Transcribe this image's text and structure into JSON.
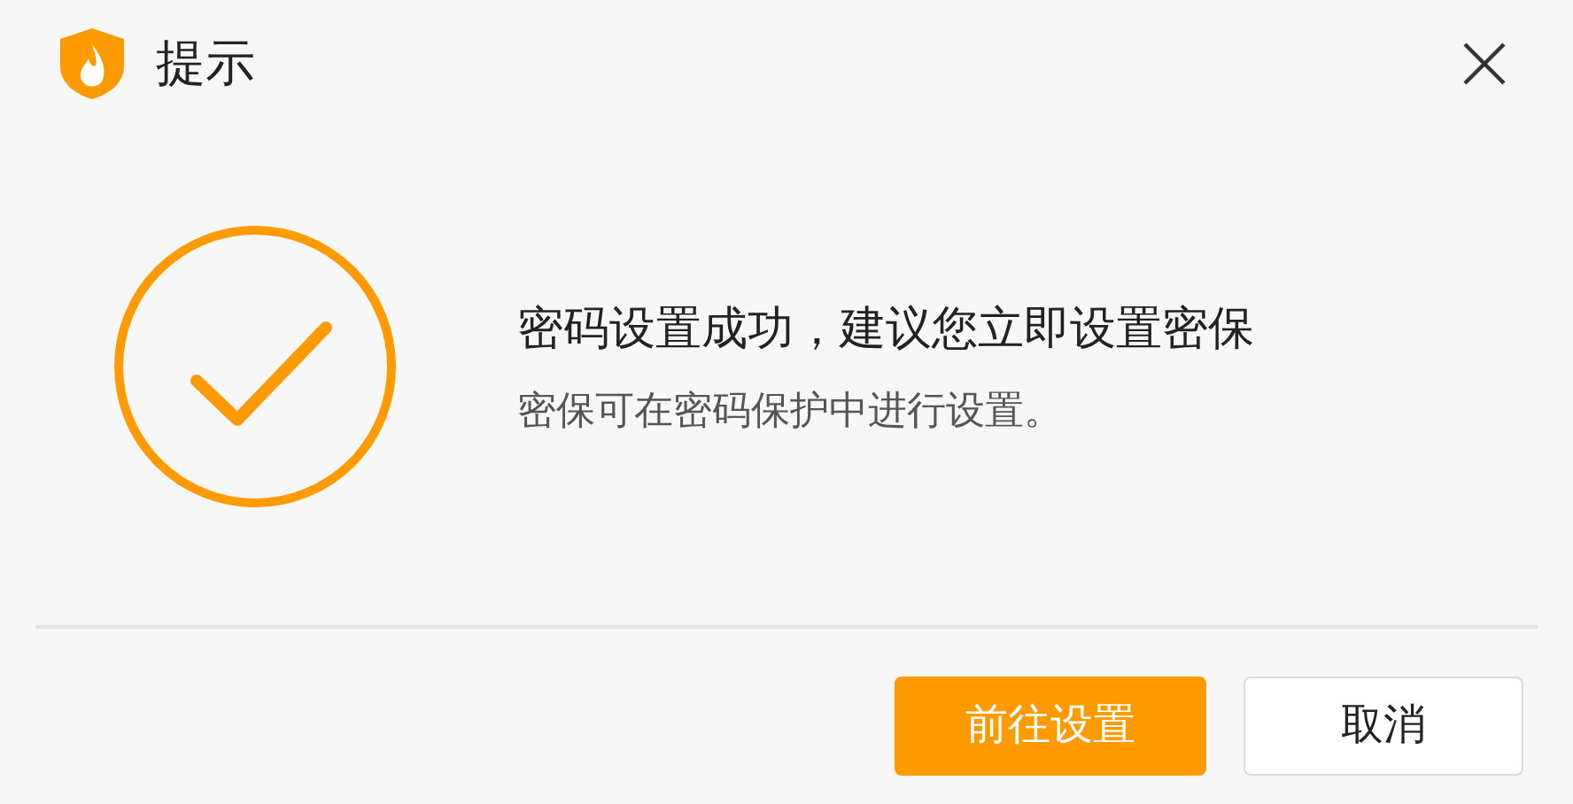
{
  "window": {
    "title": "提示"
  },
  "message": {
    "heading": "密码设置成功，建议您立即设置密保",
    "detail": "密保可在密码保护中进行设置。"
  },
  "buttons": [
    {
      "label": "前往设置",
      "kind": "primary"
    },
    {
      "label": "取消",
      "kind": "secondary"
    }
  ]
}
